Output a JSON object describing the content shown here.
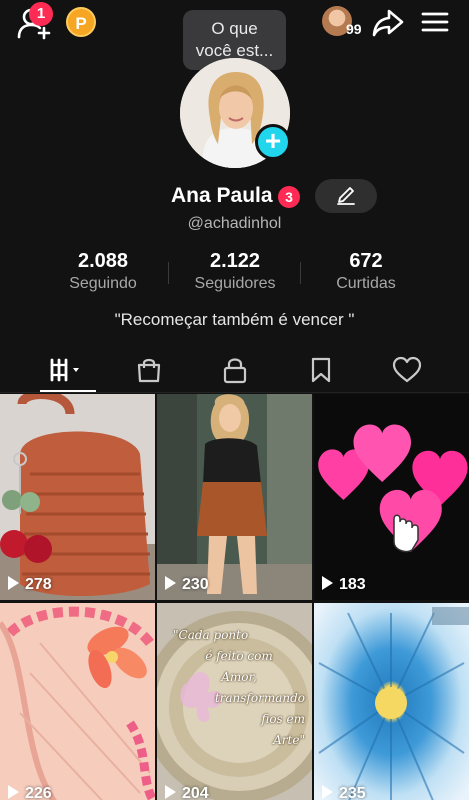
{
  "header": {
    "friend_requests_count": "1",
    "coin_label": "P",
    "tooltip_text": "O que você est...",
    "avatar_count": "99",
    "add_friend_icon": "add-friend-icon",
    "share_icon": "share-arrow-icon",
    "menu_icon": "hamburger-menu-icon"
  },
  "profile": {
    "name": "Ana Paula",
    "name_badge": "3",
    "username": "@achadinhol",
    "bio": "\"Recomeçar também é vencer \"",
    "edit_icon": "pencil-icon",
    "add_avatar_label": "+"
  },
  "stats": [
    {
      "value": "2.088",
      "label": "Seguindo"
    },
    {
      "value": "2.122",
      "label": "Seguidores"
    },
    {
      "value": "672",
      "label": "Curtidas"
    }
  ],
  "tabs": [
    {
      "icon": "videos-grid-icon",
      "active": true
    },
    {
      "icon": "shopping-bag-icon",
      "active": false
    },
    {
      "icon": "lock-icon",
      "active": false
    },
    {
      "icon": "bookmark-icon",
      "active": false
    },
    {
      "icon": "heart-icon",
      "active": false
    }
  ],
  "videos": [
    {
      "views": "278"
    },
    {
      "views": "230"
    },
    {
      "views": "183"
    },
    {
      "views": "226"
    },
    {
      "views": "204",
      "overlay_text": [
        "\"Cada ponto",
        "é feito com",
        "Amor,",
        "transformando",
        "fios em",
        "Arte\""
      ]
    },
    {
      "views": "235"
    }
  ],
  "colors": {
    "background": "#121212",
    "accent_red": "#fe2c55",
    "accent_cyan": "#20d5ec",
    "coin": "#f6a623"
  }
}
